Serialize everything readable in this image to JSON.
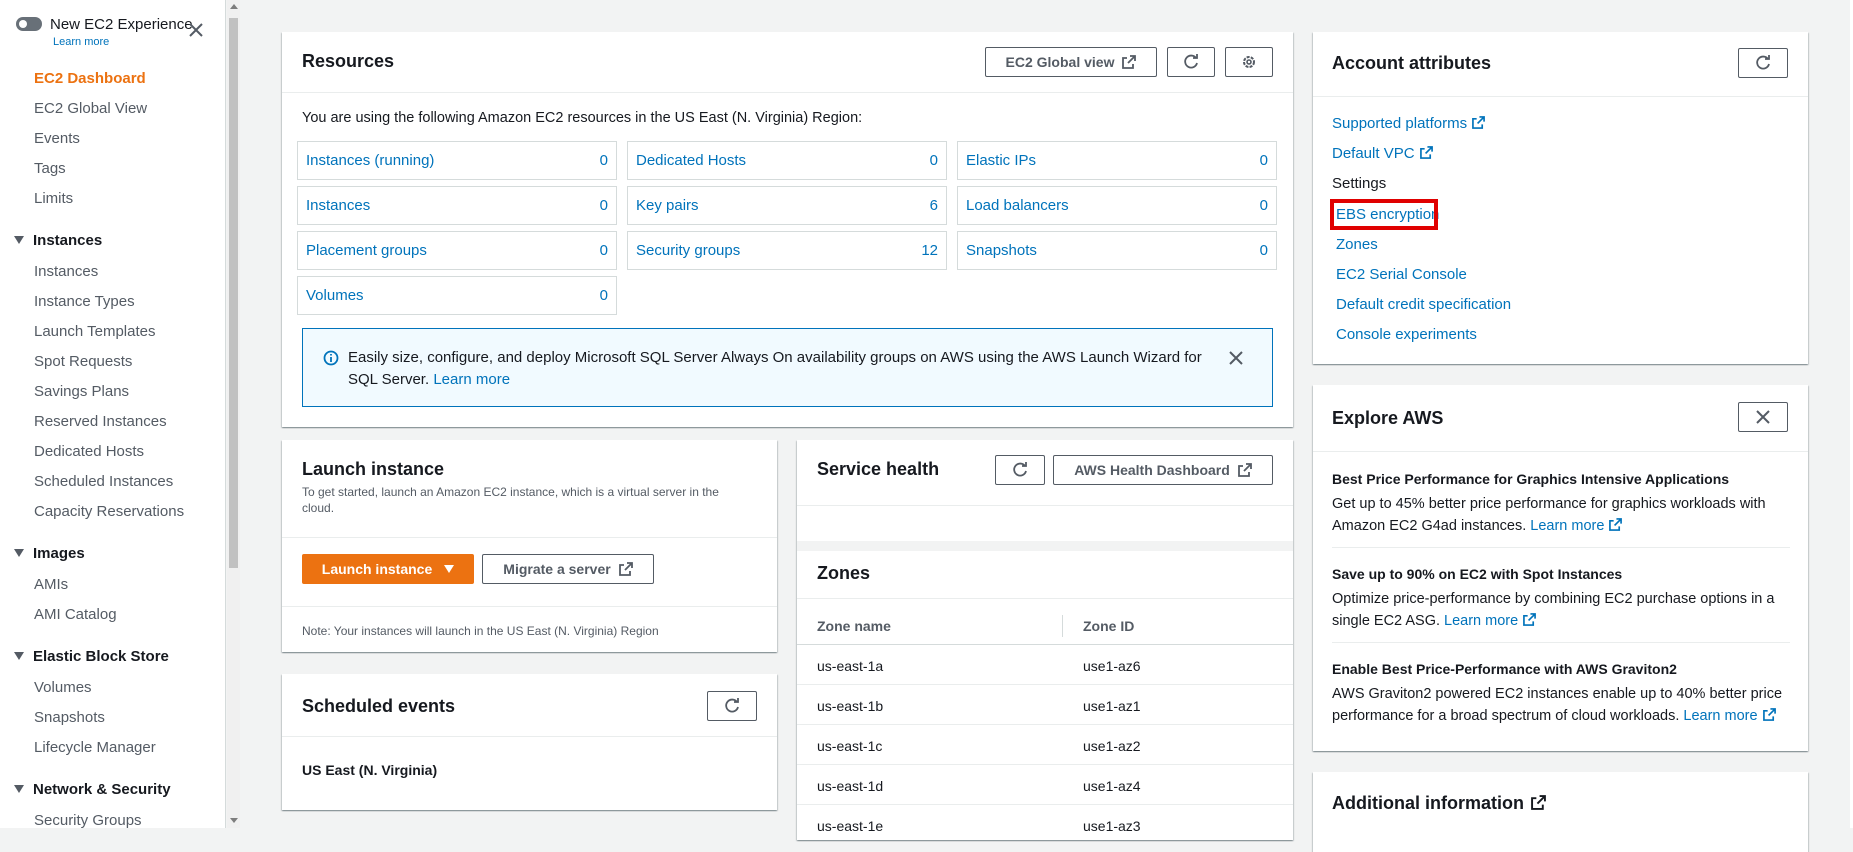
{
  "sidebar": {
    "experience_label": "New EC2 Experience",
    "experience_learn": "Learn more",
    "top_items": [
      "EC2 Dashboard",
      "EC2 Global View",
      "Events",
      "Tags",
      "Limits"
    ],
    "sections": [
      {
        "title": "Instances",
        "items": [
          "Instances",
          "Instance Types",
          "Launch Templates",
          "Spot Requests",
          "Savings Plans",
          "Reserved Instances",
          "Dedicated Hosts",
          "Scheduled Instances",
          "Capacity Reservations"
        ]
      },
      {
        "title": "Images",
        "items": [
          "AMIs",
          "AMI Catalog"
        ]
      },
      {
        "title": "Elastic Block Store",
        "items": [
          "Volumes",
          "Snapshots",
          "Lifecycle Manager"
        ]
      },
      {
        "title": "Network & Security",
        "items": [
          "Security Groups"
        ]
      }
    ]
  },
  "resources": {
    "title": "Resources",
    "global_view_btn": "EC2 Global view",
    "intro": "You are using the following Amazon EC2 resources in the US East (N. Virginia) Region:",
    "items": [
      {
        "label": "Instances (running)",
        "count": "0"
      },
      {
        "label": "Dedicated Hosts",
        "count": "0"
      },
      {
        "label": "Elastic IPs",
        "count": "0"
      },
      {
        "label": "Instances",
        "count": "0"
      },
      {
        "label": "Key pairs",
        "count": "6"
      },
      {
        "label": "Load balancers",
        "count": "0"
      },
      {
        "label": "Placement groups",
        "count": "0"
      },
      {
        "label": "Security groups",
        "count": "12"
      },
      {
        "label": "Snapshots",
        "count": "0"
      },
      {
        "label": "Volumes",
        "count": "0"
      }
    ],
    "alert_text": "Easily size, configure, and deploy Microsoft SQL Server Always On availability groups on AWS using the AWS Launch Wizard for SQL Server.",
    "alert_link": "Learn more"
  },
  "launch": {
    "title": "Launch instance",
    "desc": "To get started, launch an Amazon EC2 instance, which is a virtual server in the cloud.",
    "launch_btn": "Launch instance",
    "migrate_btn": "Migrate a server",
    "note": "Note: Your instances will launch in the US East (N. Virginia) Region"
  },
  "scheduled": {
    "title": "Scheduled events",
    "region": "US East (N. Virginia)"
  },
  "health": {
    "title": "Service health",
    "dashboard_btn": "AWS Health Dashboard"
  },
  "zones": {
    "title": "Zones",
    "col_name": "Zone name",
    "col_id": "Zone ID",
    "rows": [
      {
        "name": "us-east-1a",
        "id": "use1-az6"
      },
      {
        "name": "us-east-1b",
        "id": "use1-az1"
      },
      {
        "name": "us-east-1c",
        "id": "use1-az2"
      },
      {
        "name": "us-east-1d",
        "id": "use1-az4"
      },
      {
        "name": "us-east-1e",
        "id": "use1-az3"
      }
    ]
  },
  "account": {
    "title": "Account attributes",
    "supported_platforms": "Supported platforms",
    "default_vpc": "Default VPC",
    "settings": "Settings",
    "settings_items": [
      "EBS encryption",
      "Zones",
      "EC2 Serial Console",
      "Default credit specification",
      "Console experiments"
    ]
  },
  "explore": {
    "title": "Explore AWS",
    "items": [
      {
        "heading": "Best Price Performance for Graphics Intensive Applications",
        "body": "Get up to 45% better price performance for graphics workloads with Amazon EC2 G4ad instances.",
        "link": "Learn more"
      },
      {
        "heading": "Save up to 90% on EC2 with Spot Instances",
        "body": "Optimize price-performance by combining EC2 purchase options in a single EC2 ASG.",
        "link": "Learn more"
      },
      {
        "heading": "Enable Best Price-Performance with AWS Graviton2",
        "body": "AWS Graviton2 powered EC2 instances enable up to 40% better price performance for a broad spectrum of cloud workloads.",
        "link": "Learn more"
      }
    ]
  },
  "additional": {
    "title": "Additional information"
  },
  "colors": {
    "accent": "#ec7211",
    "link": "#0073bb",
    "highlight": "#e00000"
  }
}
